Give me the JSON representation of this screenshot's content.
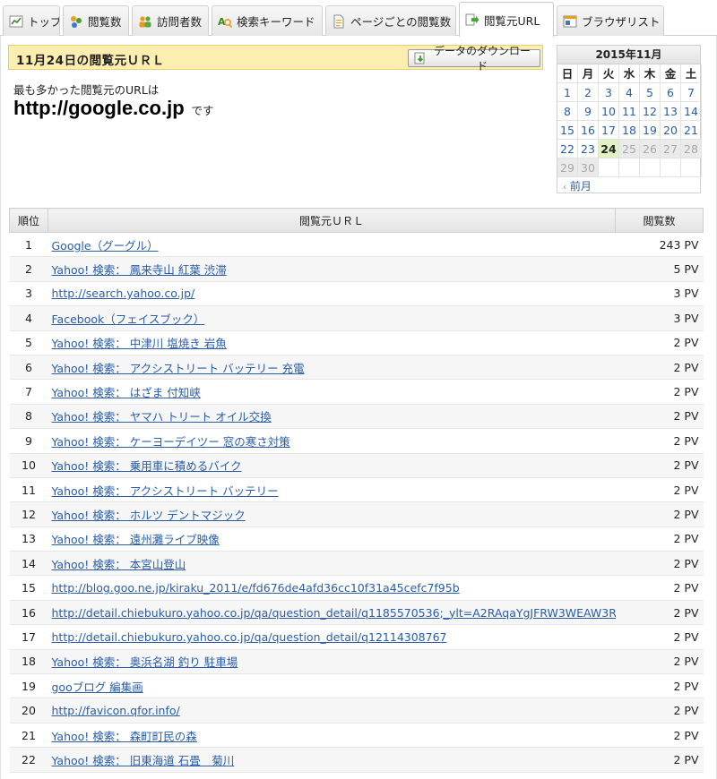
{
  "tabs": [
    {
      "label": "トップ",
      "icon": "line-chart-icon"
    },
    {
      "label": "閲覧数",
      "icon": "pageview-icon"
    },
    {
      "label": "訪問者数",
      "icon": "users-icon"
    },
    {
      "label": "検索キーワード",
      "icon": "keyword-search-icon"
    },
    {
      "label": "ページごとの閲覧数",
      "icon": "page-document-icon"
    },
    {
      "label": "閲覧元URL",
      "icon": "referrer-arrow-icon",
      "active": true
    },
    {
      "label": "ブラウザリスト",
      "icon": "browser-window-icon"
    }
  ],
  "header": {
    "title": "11月24日の閲覧元ＵＲＬ",
    "download_label": "データのダウンロード",
    "download_icon": "download-arrow-icon"
  },
  "summary": {
    "intro": "最も多かった閲覧元のURLは",
    "top_url": "http://google.co.jp",
    "suffix": "です"
  },
  "calendar": {
    "title": "2015年11月",
    "weekdays": [
      "日",
      "月",
      "火",
      "水",
      "木",
      "金",
      "土"
    ],
    "days": [
      "1",
      "2",
      "3",
      "4",
      "5",
      "6",
      "7",
      "8",
      "9",
      "10",
      "11",
      "12",
      "13",
      "14",
      "15",
      "16",
      "17",
      "18",
      "19",
      "20",
      "21",
      "22",
      "23",
      "24",
      "25",
      "26",
      "27",
      "28",
      "29",
      "30"
    ],
    "today": "24",
    "prev_label": "前月",
    "prev_icon": "chevron-left-icon"
  },
  "table": {
    "headers": {
      "rank": "順位",
      "url": "閲覧元ＵＲＬ",
      "views": "閲覧数"
    },
    "rows": [
      {
        "rank": "1",
        "url": "Google（グーグル）",
        "views": "243 PV"
      },
      {
        "rank": "2",
        "url": "Yahoo! 検索： 鳳来寺山 紅葉 渋滞",
        "views": "5 PV"
      },
      {
        "rank": "3",
        "url": "http://search.yahoo.co.jp/",
        "views": "3 PV"
      },
      {
        "rank": "4",
        "url": "Facebook（フェイスブック）",
        "views": "3 PV"
      },
      {
        "rank": "5",
        "url": "Yahoo! 検索： 中津川 塩焼き 岩魚",
        "views": "2 PV"
      },
      {
        "rank": "6",
        "url": "Yahoo! 検索： アクシストリート バッテリー 充電",
        "views": "2 PV"
      },
      {
        "rank": "7",
        "url": "Yahoo! 検索： はざま 付知峡",
        "views": "2 PV"
      },
      {
        "rank": "8",
        "url": "Yahoo! 検索： ヤマハ トリート オイル交換",
        "views": "2 PV"
      },
      {
        "rank": "9",
        "url": "Yahoo! 検索： ケーヨーデイツー 窓の寒さ対策",
        "views": "2 PV"
      },
      {
        "rank": "10",
        "url": "Yahoo! 検索： 乗用車に積めるバイク",
        "views": "2 PV"
      },
      {
        "rank": "11",
        "url": "Yahoo! 検索： アクシストリート バッテリー",
        "views": "2 PV"
      },
      {
        "rank": "12",
        "url": "Yahoo! 検索： ホルツ デントマジック",
        "views": "2 PV"
      },
      {
        "rank": "13",
        "url": "Yahoo! 検索： 遠州灘ライブ映像",
        "views": "2 PV"
      },
      {
        "rank": "14",
        "url": "Yahoo! 検索： 本宮山登山",
        "views": "2 PV"
      },
      {
        "rank": "15",
        "url": "http://blog.goo.ne.jp/kiraku_2011/e/fd676de4afd36cc10f31a45cefc7f95b",
        "views": "2 PV"
      },
      {
        "rank": "16",
        "url": "http://detail.chiebukuro.yahoo.co.jp/qa/question_detail/q1185570536;_ylt=A2RAqaYgJFRW3WEAW3R",
        "views": "2 PV"
      },
      {
        "rank": "17",
        "url": "http://detail.chiebukuro.yahoo.co.jp/qa/question_detail/q12114308767",
        "views": "2 PV"
      },
      {
        "rank": "18",
        "url": "Yahoo! 検索： 奥浜名湖 釣り 駐車場",
        "views": "2 PV"
      },
      {
        "rank": "19",
        "url": "gooブログ 編集画",
        "views": "2 PV"
      },
      {
        "rank": "20",
        "url": "http://favicon.qfor.info/",
        "views": "2 PV"
      },
      {
        "rank": "21",
        "url": "Yahoo! 検索： 森町町民の森",
        "views": "2 PV"
      },
      {
        "rank": "22",
        "url": "Yahoo! 検索： 旧東海道 石畳　菊川",
        "views": "2 PV"
      }
    ]
  }
}
